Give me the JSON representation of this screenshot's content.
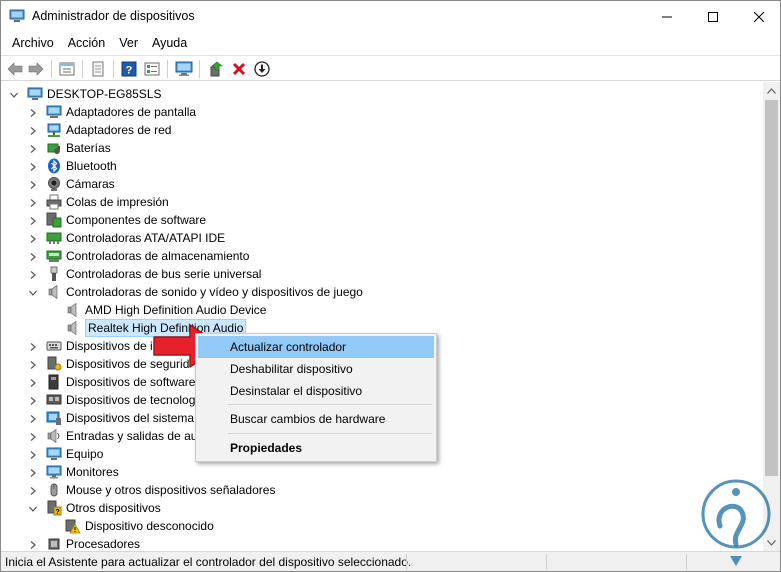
{
  "window": {
    "title": "Administrador de dispositivos"
  },
  "menu": {
    "items": [
      "Archivo",
      "Acción",
      "Ver",
      "Ayuda"
    ]
  },
  "toolbar": {
    "buttons": [
      "back-icon",
      "forward-icon",
      "properties-pane-icon",
      "document-icon",
      "help-icon",
      "list-view-icon",
      "monitor-icon",
      "update-driver-icon",
      "uninstall-icon",
      "download-icon"
    ]
  },
  "tree": {
    "root": "DESKTOP-EG85SLS",
    "items": [
      {
        "label": "Adaptadores de pantalla",
        "icon": "display-adapter-icon",
        "state": "collapsed"
      },
      {
        "label": "Adaptadores de red",
        "icon": "network-adapter-icon",
        "state": "collapsed"
      },
      {
        "label": "Baterías",
        "icon": "battery-icon",
        "state": "collapsed"
      },
      {
        "label": "Bluetooth",
        "icon": "bluetooth-icon",
        "state": "collapsed"
      },
      {
        "label": "Cámaras",
        "icon": "camera-icon",
        "state": "collapsed"
      },
      {
        "label": "Colas de impresión",
        "icon": "printer-icon",
        "state": "collapsed"
      },
      {
        "label": "Componentes de software",
        "icon": "software-component-icon",
        "state": "collapsed"
      },
      {
        "label": "Controladoras ATA/ATAPI IDE",
        "icon": "ide-controller-icon",
        "state": "collapsed"
      },
      {
        "label": "Controladoras de almacenamiento",
        "icon": "storage-controller-icon",
        "state": "collapsed"
      },
      {
        "label": "Controladoras de bus serie universal",
        "icon": "usb-icon",
        "state": "collapsed"
      },
      {
        "label": "Controladoras de sonido y vídeo y dispositivos de juego",
        "icon": "speaker-icon",
        "state": "expanded"
      },
      {
        "label": "AMD High Definition Audio Device",
        "icon": "speaker-icon",
        "state": "child"
      },
      {
        "label": "Realtek High Definition Audio",
        "icon": "speaker-icon",
        "state": "child-selected"
      },
      {
        "label": "Dispositivos de interfaz d",
        "icon": "hid-icon",
        "state": "collapsed"
      },
      {
        "label": "Dispositivos de segurid",
        "icon": "security-device-icon",
        "state": "collapsed"
      },
      {
        "label": "Dispositivos de software",
        "icon": "software-device-icon",
        "state": "collapsed"
      },
      {
        "label": "Dispositivos de tecnolog",
        "icon": "memory-tech-icon",
        "state": "collapsed"
      },
      {
        "label": "Dispositivos del sistema",
        "icon": "system-device-icon",
        "state": "collapsed"
      },
      {
        "label": "Entradas y salidas de aud",
        "icon": "audio-io-icon",
        "state": "collapsed"
      },
      {
        "label": "Equipo",
        "icon": "computer-icon",
        "state": "collapsed"
      },
      {
        "label": "Monitores",
        "icon": "monitor-icon",
        "state": "collapsed"
      },
      {
        "label": "Mouse y otros dispositivos señaladores",
        "icon": "mouse-icon",
        "state": "collapsed"
      },
      {
        "label": "Otros dispositivos",
        "icon": "unknown-device-icon",
        "state": "expanded"
      },
      {
        "label": "Dispositivo desconocido",
        "icon": "warning-device-icon",
        "state": "child"
      },
      {
        "label": "Procesadores",
        "icon": "processor-icon",
        "state": "collapsed"
      }
    ]
  },
  "context_menu": {
    "items": [
      {
        "label": "Actualizar controlador",
        "highlight": true,
        "bold": false
      },
      {
        "label": "Deshabilitar dispositivo",
        "highlight": false,
        "bold": false
      },
      {
        "label": "Desinstalar el dispositivo",
        "highlight": false,
        "bold": false
      },
      {
        "label": "Buscar cambios de hardware",
        "highlight": false,
        "bold": false
      },
      {
        "label": "Propiedades",
        "highlight": false,
        "bold": true
      }
    ]
  },
  "status": {
    "text": "Inicia el Asistente para actualizar el controlador del dispositivo seleccionado."
  },
  "colors": {
    "selection": "#cce8ff",
    "menu_highlight": "#91c9f7",
    "arrow": "#e8202a",
    "watermark": "#1d6fa5"
  }
}
